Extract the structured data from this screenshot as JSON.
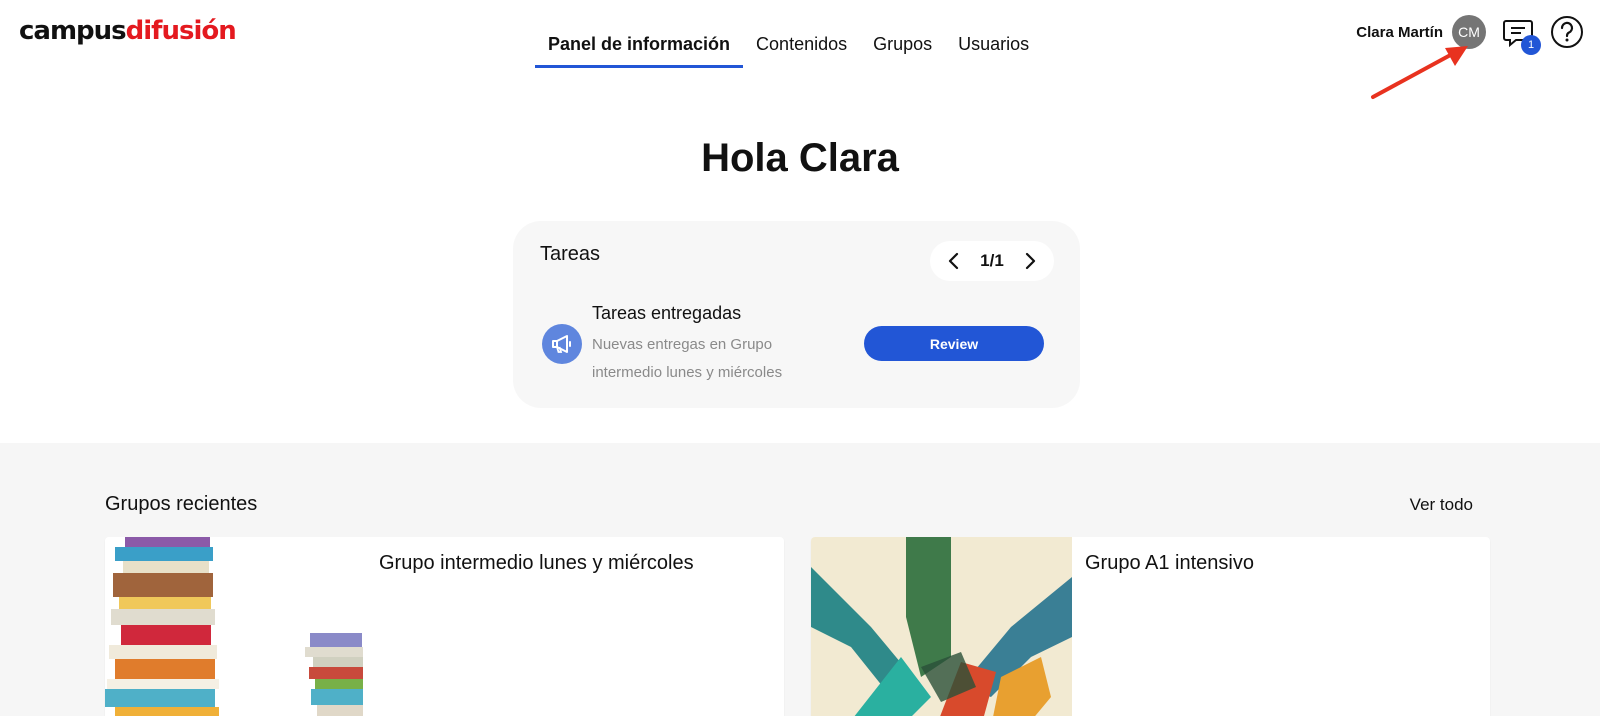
{
  "header": {
    "logo_part1": "campus",
    "logo_part2": "difusión",
    "nav": [
      {
        "label": "Panel de información",
        "active": true
      },
      {
        "label": "Contenidos",
        "active": false
      },
      {
        "label": "Grupos",
        "active": false
      },
      {
        "label": "Usuarios",
        "active": false
      }
    ],
    "user_name": "Clara Martín",
    "avatar_initials": "CM",
    "messages_badge": "1",
    "icons": [
      "chat-icon",
      "help-icon"
    ]
  },
  "greeting": "Hola Clara",
  "tasks": {
    "title": "Tareas",
    "pager": "1/1",
    "item": {
      "icon": "megaphone-icon",
      "title": "Tareas entregadas",
      "description": "Nuevas entregas en Grupo intermedio lunes y miércoles",
      "button": "Review"
    }
  },
  "groups": {
    "title": "Grupos recientes",
    "see_all": "Ver todo",
    "items": [
      {
        "name": "Grupo intermedio lunes y miércoles",
        "image": "books-illustration"
      },
      {
        "name": "Grupo A1 intensivo",
        "image": "hands-illustration"
      }
    ]
  },
  "colors": {
    "accent": "#2256d6",
    "brand_red": "#e4191f",
    "annotation_arrow": "#e8321f"
  }
}
